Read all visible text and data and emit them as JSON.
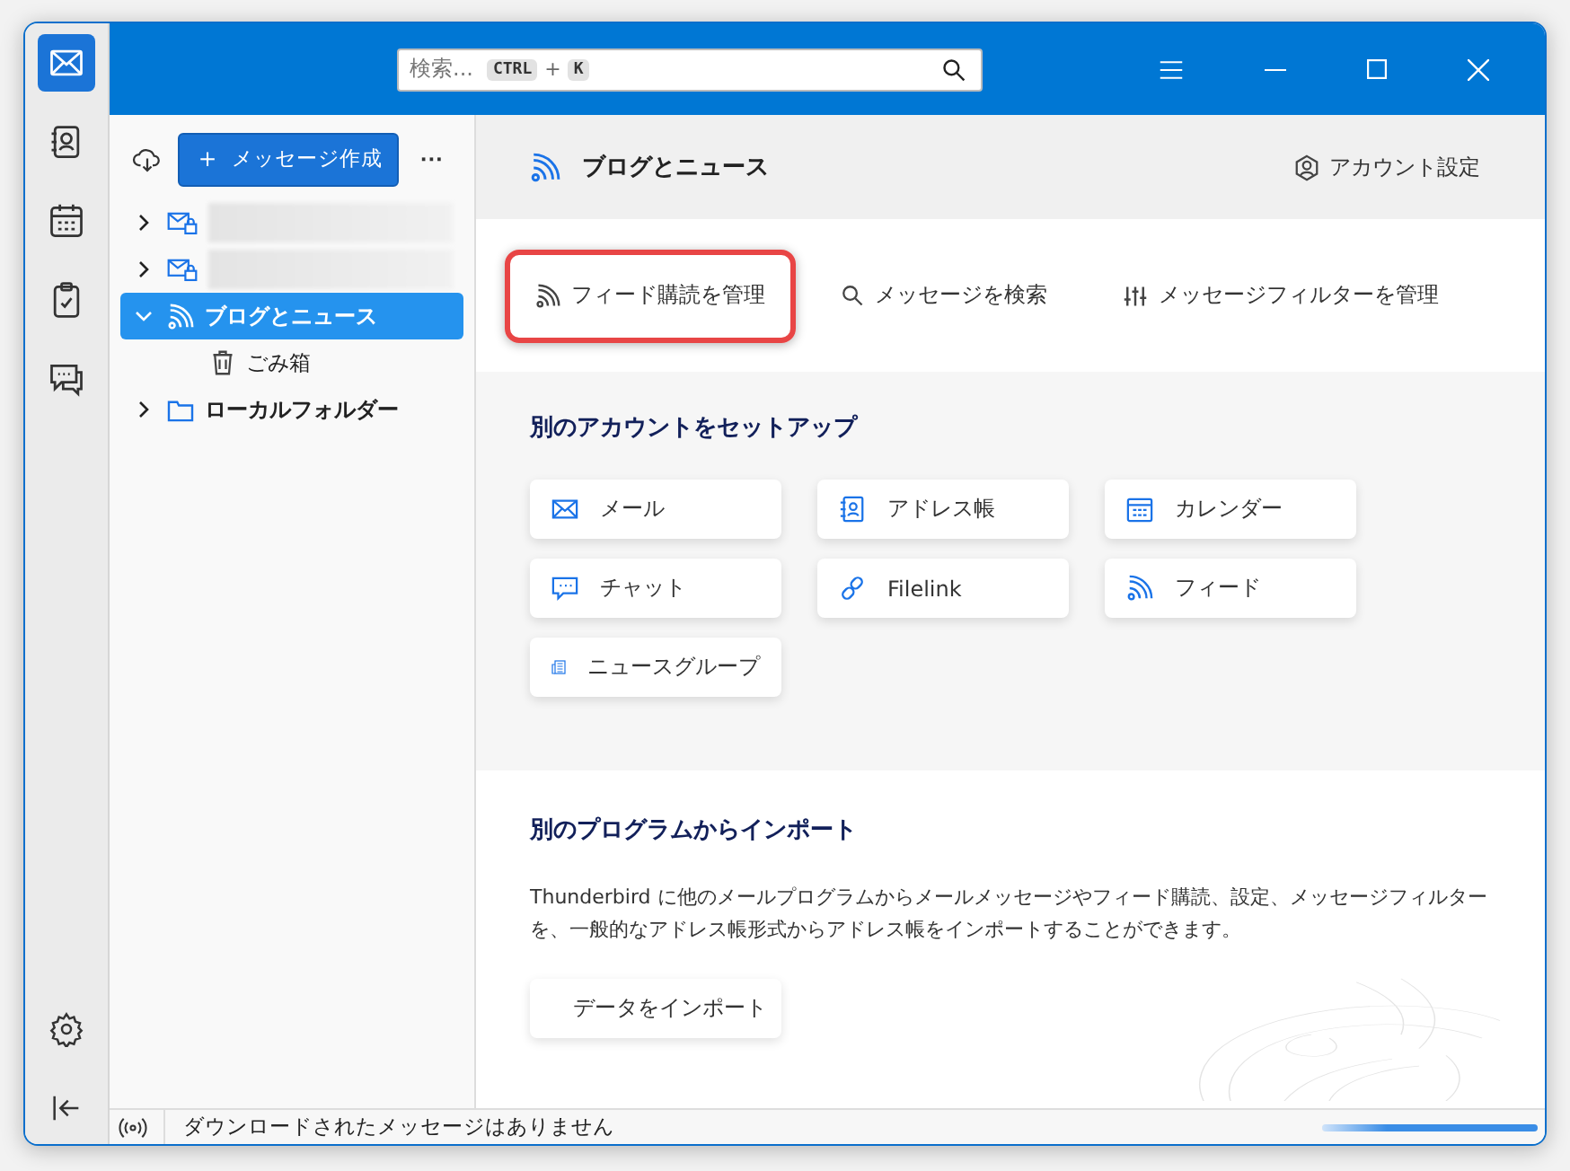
{
  "spaces_bar": [
    {
      "kind": "mail",
      "selected": true
    },
    {
      "kind": "address-book",
      "selected": false
    },
    {
      "kind": "calendar",
      "selected": false
    },
    {
      "kind": "tasks",
      "selected": false
    },
    {
      "kind": "chat",
      "selected": false
    }
  ],
  "search": {
    "placeholder": "検索...",
    "shortcut_keys": [
      "CTRL",
      "K"
    ],
    "shortcut_join": "+"
  },
  "folder_pane": {
    "compose_button": {
      "icon": "＋",
      "label": "メッセージ作成"
    },
    "more_button": "···",
    "folders": [
      {
        "kind": "mail-account",
        "redacted": true,
        "expanded": false,
        "selected": false
      },
      {
        "kind": "mail-account",
        "redacted": true,
        "expanded": false,
        "selected": false
      },
      {
        "kind": "feed",
        "label": "ブログとニュース",
        "redacted": false,
        "expanded": true,
        "selected": true,
        "children": [
          {
            "kind": "trash",
            "label": "ごみ箱",
            "redacted": false,
            "expanded": false,
            "selected": false
          }
        ]
      },
      {
        "kind": "folder",
        "label": "ローカルフォルダー",
        "redacted": false,
        "expanded": false,
        "selected": false
      }
    ]
  },
  "account_header": {
    "title": "ブログとニュース",
    "settings_link": "アカウント設定"
  },
  "actions": [
    {
      "kind": "feed",
      "label": "フィード購読を管理",
      "highlighted": true
    },
    {
      "kind": "search",
      "label": "メッセージを検索",
      "highlighted": false
    },
    {
      "kind": "filter",
      "label": "メッセージフィルターを管理",
      "highlighted": false
    }
  ],
  "setup_section": {
    "title": "別のアカウントをセットアップ",
    "items": [
      {
        "kind": "mail",
        "label": "メール"
      },
      {
        "kind": "address-book",
        "label": "アドレス帳"
      },
      {
        "kind": "calendar",
        "label": "カレンダー"
      },
      {
        "kind": "chat",
        "label": "チャット"
      },
      {
        "kind": "link",
        "label": "Filelink"
      },
      {
        "kind": "feed",
        "label": "フィード"
      },
      {
        "kind": "newsgroup",
        "label": "ニュースグループ"
      }
    ]
  },
  "import_section": {
    "title": "別のプログラムからインポート",
    "description": "Thunderbird に他のメールプログラムからメールメッセージやフィード購読、設定、メッセージフィルターを、一般的なアドレス帳形式からアドレス帳をインポートすることができます。",
    "button": "データをインポート"
  },
  "status_bar": {
    "message": "ダウンロードされたメッセージはありません",
    "progress": {
      "level": 1
    }
  }
}
